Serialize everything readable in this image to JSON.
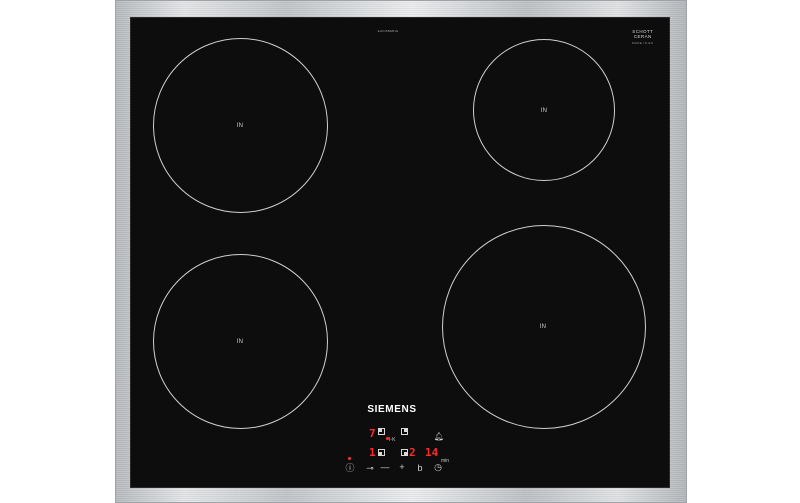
{
  "hob": {
    "brand": "SIEMENS",
    "model_print": "EH645BEB1E",
    "glass_maker": [
      "SCHOTT",
      "CERAN"
    ],
    "glass_maker_sub": "MADE IN EU",
    "zones": [
      {
        "id": "rear-left",
        "label": "IN"
      },
      {
        "id": "rear-right",
        "label": "IN"
      },
      {
        "id": "front-left",
        "label": "IN"
      },
      {
        "id": "front-right",
        "label": "IN"
      }
    ],
    "display": {
      "rear_left_level": "7",
      "front_left_level": "1",
      "timer_digit_a": "2",
      "timer_digit_b": "14",
      "timer_unit": "min",
      "digit_color": "#ff2a2a"
    },
    "controls": [
      {
        "name": "power-icon",
        "glyph": "ⓘ"
      },
      {
        "name": "child-lock-icon",
        "glyph": "⊸"
      },
      {
        "name": "minus-icon",
        "glyph": "—"
      },
      {
        "name": "plus-icon",
        "glyph": "+"
      },
      {
        "name": "powerboost-icon",
        "glyph": "b"
      },
      {
        "name": "timer-icon",
        "glyph": "◷"
      }
    ]
  }
}
